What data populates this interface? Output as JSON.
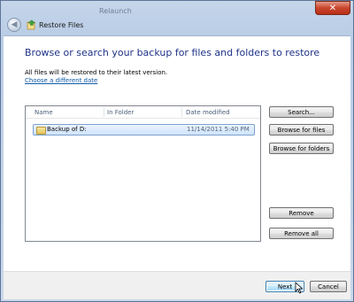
{
  "window": {
    "ghost_title": "Relaunch",
    "close_label": "✕",
    "app_title": "Restore Files",
    "back_label": "◀"
  },
  "content": {
    "heading": "Browse or search your backup for files and folders to restore",
    "info": "All files will be restored to their latest version.",
    "link": "Choose a different date"
  },
  "list": {
    "columns": [
      "Name",
      "In Folder",
      "Date modified"
    ],
    "rows": [
      {
        "name": "Backup of D:",
        "folder": "",
        "date": "11/14/2011 5:40 PM",
        "selected": true
      }
    ]
  },
  "side_buttons": {
    "search": "Search...",
    "browse_files": "Browse for files",
    "browse_folders": "Browse for folders",
    "remove": "Remove",
    "remove_all": "Remove all"
  },
  "footer": {
    "next": "Next",
    "cancel": "Cancel"
  },
  "icons": {
    "back": "back-arrow-icon",
    "app": "restore-files-icon",
    "folder": "folder-icon",
    "close": "close-icon"
  },
  "colors": {
    "heading": "#1e3287",
    "link": "#0f5aa8",
    "selection": "#cfe4fc"
  }
}
